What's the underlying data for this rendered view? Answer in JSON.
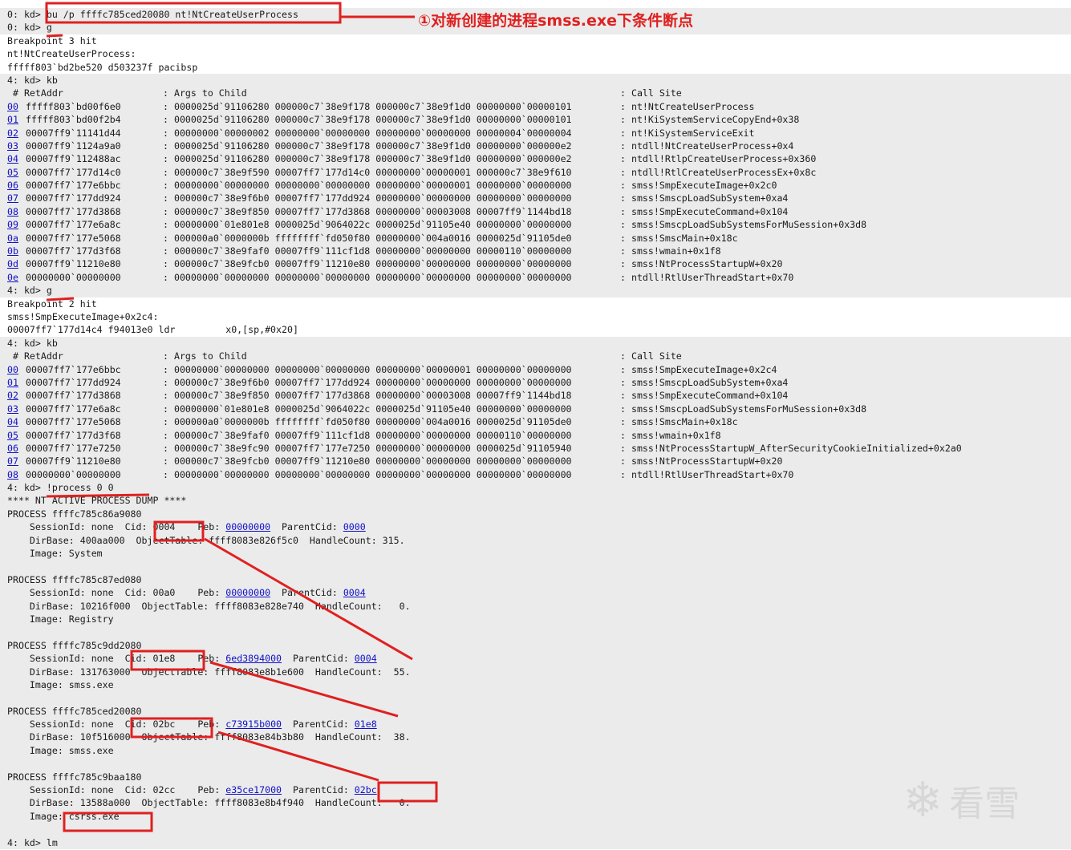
{
  "annotation": {
    "note": "①对新创建的进程smss.exe下条件断点",
    "color": "#e02020"
  },
  "watermark": {
    "text": "看雪",
    "icon": "snowflake-icon"
  },
  "link_color": "#1010c8",
  "console": {
    "cmd_bp": "0: kd> bu /p ffffc785ced20080 nt!NtCreateUserProcess",
    "cmd_g1": "0: kd> g",
    "bp3_hit": "Breakpoint 3 hit",
    "bp3_sym": "nt!NtCreateUserProcess:",
    "bp3_instr": "fffff803`bd2be520 d503237f pacibsp",
    "cmd_kb1": "4: kd> kb",
    "kb_header": {
      "num": " # RetAddr",
      "args": ": Args to Child",
      "site": ": Call Site"
    },
    "stack1": [
      {
        "n": "00",
        "ret": "fffff803`bd00f6e0",
        "args": "0000025d`91106280 000000c7`38e9f178 000000c7`38e9f1d0 00000000`00000101",
        "site": "nt!NtCreateUserProcess"
      },
      {
        "n": "01",
        "ret": "fffff803`bd00f2b4",
        "args": "0000025d`91106280 000000c7`38e9f178 000000c7`38e9f1d0 00000000`00000101",
        "site": "nt!KiSystemServiceCopyEnd+0x38"
      },
      {
        "n": "02",
        "ret": "00007ff9`11141d44",
        "args": "00000000`00000002 00000000`00000000 00000000`00000000 00000004`00000004",
        "site": "nt!KiSystemServiceExit"
      },
      {
        "n": "03",
        "ret": "00007ff9`1124a9a0",
        "args": "0000025d`91106280 000000c7`38e9f178 000000c7`38e9f1d0 00000000`000000e2",
        "site": "ntdll!NtCreateUserProcess+0x4"
      },
      {
        "n": "04",
        "ret": "00007ff9`112488ac",
        "args": "0000025d`91106280 000000c7`38e9f178 000000c7`38e9f1d0 00000000`000000e2",
        "site": "ntdll!RtlpCreateUserProcess+0x360"
      },
      {
        "n": "05",
        "ret": "00007ff7`177d14c0",
        "args": "000000c7`38e9f590 00007ff7`177d14c0 00000000`00000001 000000c7`38e9f610",
        "site": "ntdll!RtlCreateUserProcessEx+0x8c"
      },
      {
        "n": "06",
        "ret": "00007ff7`177e6bbc",
        "args": "00000000`00000000 00000000`00000000 00000000`00000001 00000000`00000000",
        "site": "smss!SmpExecuteImage+0x2c0"
      },
      {
        "n": "07",
        "ret": "00007ff7`177dd924",
        "args": "000000c7`38e9f6b0 00007ff7`177dd924 00000000`00000000 00000000`00000000",
        "site": "smss!SmscpLoadSubSystem+0xa4"
      },
      {
        "n": "08",
        "ret": "00007ff7`177d3868",
        "args": "000000c7`38e9f850 00007ff7`177d3868 00000000`00003008 00007ff9`1144bd18",
        "site": "smss!SmpExecuteCommand+0x104"
      },
      {
        "n": "09",
        "ret": "00007ff7`177e6a8c",
        "args": "00000000`01e801e8 0000025d`9064022c 0000025d`91105e40 00000000`00000000",
        "site": "smss!SmscpLoadSubSystemsForMuSession+0x3d8"
      },
      {
        "n": "0a",
        "ret": "00007ff7`177e5068",
        "args": "000000a0`0000000b ffffffff`fd050f80 00000000`004a0016 0000025d`91105de0",
        "site": "smss!SmscMain+0x18c"
      },
      {
        "n": "0b",
        "ret": "00007ff7`177d3f68",
        "args": "000000c7`38e9faf0 00007ff9`111cf1d8 00000000`00000000 00000110`00000000",
        "site": "smss!wmain+0x1f8"
      },
      {
        "n": "0d",
        "ret": "00007ff9`11210e80",
        "args": "000000c7`38e9fcb0 00007ff9`11210e80 00000000`00000000 00000000`00000000",
        "site": "smss!NtProcessStartupW+0x20"
      },
      {
        "n": "0e",
        "ret": "00000000`00000000",
        "args": "00000000`00000000 00000000`00000000 00000000`00000000 00000000`00000000",
        "site": "ntdll!RtlUserThreadStart+0x70"
      }
    ],
    "cmd_g2": "4: kd> g",
    "bp2_hit": "Breakpoint 2 hit",
    "bp2_sym": "smss!SmpExecuteImage+0x2c4:",
    "bp2_instr": "00007ff7`177d14c4 f94013e0 ldr         x0,[sp,#0x20]",
    "cmd_kb2": "4: kd> kb",
    "stack2": [
      {
        "n": "00",
        "ret": "00007ff7`177e6bbc",
        "args": "00000000`00000000 00000000`00000000 00000000`00000001 00000000`00000000",
        "site": "smss!SmpExecuteImage+0x2c4"
      },
      {
        "n": "01",
        "ret": "00007ff7`177dd924",
        "args": "000000c7`38e9f6b0 00007ff7`177dd924 00000000`00000000 00000000`00000000",
        "site": "smss!SmscpLoadSubSystem+0xa4"
      },
      {
        "n": "02",
        "ret": "00007ff7`177d3868",
        "args": "000000c7`38e9f850 00007ff7`177d3868 00000000`00003008 00007ff9`1144bd18",
        "site": "smss!SmpExecuteCommand+0x104"
      },
      {
        "n": "03",
        "ret": "00007ff7`177e6a8c",
        "args": "00000000`01e801e8 0000025d`9064022c 0000025d`91105e40 00000000`00000000",
        "site": "smss!SmscpLoadSubSystemsForMuSession+0x3d8"
      },
      {
        "n": "04",
        "ret": "00007ff7`177e5068",
        "args": "000000a0`0000000b ffffffff`fd050f80 00000000`004a0016 0000025d`91105de0",
        "site": "smss!SmscMain+0x18c"
      },
      {
        "n": "05",
        "ret": "00007ff7`177d3f68",
        "args": "000000c7`38e9faf0 00007ff9`111cf1d8 00000000`00000000 00000110`00000000",
        "site": "smss!wmain+0x1f8"
      },
      {
        "n": "06",
        "ret": "00007ff7`177e7250",
        "args": "000000c7`38e9fc90 00007ff7`177e7250 00000000`00000000 0000025d`91105940",
        "site": "smss!NtProcessStartupW_AfterSecurityCookieInitialized+0x2a0"
      },
      {
        "n": "07",
        "ret": "00007ff9`11210e80",
        "args": "000000c7`38e9fcb0 00007ff9`11210e80 00000000`00000000 00000000`00000000",
        "site": "smss!NtProcessStartupW+0x20"
      },
      {
        "n": "08",
        "ret": "00000000`00000000",
        "args": "00000000`00000000 00000000`00000000 00000000`00000000 00000000`00000000",
        "site": "ntdll!RtlUserThreadStart+0x70"
      }
    ],
    "cmd_process": "4: kd> !process 0 0",
    "dump_header": "**** NT ACTIVE PROCESS DUMP ****",
    "processes": [
      {
        "process": "PROCESS ffffc785c86a9080",
        "session": "    SessionId: none  Cid: 0004    Peb: ",
        "peb": "00000000",
        "parent_label": "  ParentCid: ",
        "parent": "0000",
        "dirbase": "    DirBase: 400aa000  ObjectTable: ffff8083e826f5c0  HandleCount: 315.",
        "image": "    Image: System"
      },
      {
        "process": "PROCESS ffffc785c87ed080",
        "session": "    SessionId: none  Cid: 00a0    Peb: ",
        "peb": "00000000",
        "parent_label": "  ParentCid: ",
        "parent": "0004",
        "dirbase": "    DirBase: 10216f000  ObjectTable: ffff8083e828e740  HandleCount:   0.",
        "image": "    Image: Registry"
      },
      {
        "process": "PROCESS ffffc785c9dd2080",
        "session": "    SessionId: none  Cid: 01e8    Peb: ",
        "peb": "6ed3894000",
        "parent_label": "  ParentCid: ",
        "parent": "0004",
        "dirbase": "    DirBase: 131763000  ObjectTable: ffff8083e8b1e600  HandleCount:  55.",
        "image": "    Image: smss.exe"
      },
      {
        "process": "PROCESS ffffc785ced20080",
        "session": "    SessionId: none  Cid: 02bc    Peb: ",
        "peb": "c73915b000",
        "parent_label": "  ParentCid: ",
        "parent": "01e8",
        "dirbase": "    DirBase: 10f516000  ObjectTable: ffff8083e84b3b80  HandleCount:  38.",
        "image": "    Image: smss.exe"
      },
      {
        "process": "PROCESS ffffc785c9baa180",
        "session": "    SessionId: none  Cid: 02cc    Peb: ",
        "peb": "e35ce17000",
        "parent_label": "  ParentCid: ",
        "parent": "02bc",
        "dirbase": "    DirBase: 13588a000  ObjectTable: ffff8083e8b4f940  HandleCount:   0.",
        "image": "    Image: csrss.exe"
      }
    ],
    "cmd_lm": "4: kd> lm"
  }
}
